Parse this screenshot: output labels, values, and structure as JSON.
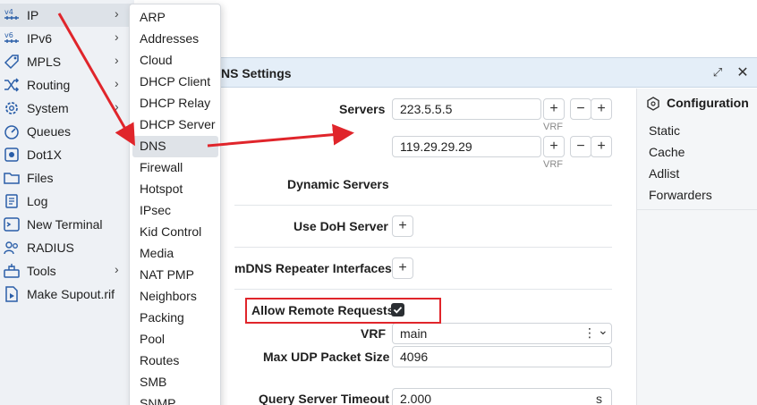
{
  "sidebar": {
    "items": [
      {
        "label": "IP",
        "icon": "ipv4-icon",
        "chevron": "›"
      },
      {
        "label": "IPv6",
        "icon": "ipv6-icon",
        "chevron": "›"
      },
      {
        "label": "MPLS",
        "icon": "tag-icon",
        "chevron": "›"
      },
      {
        "label": "Routing",
        "icon": "shuffle-icon",
        "chevron": "›"
      },
      {
        "label": "System",
        "icon": "gear-icon",
        "chevron": "›"
      },
      {
        "label": "Queues",
        "icon": "gauge-icon",
        "chevron": ""
      },
      {
        "label": "Dot1X",
        "icon": "dot1x-icon",
        "chevron": ""
      },
      {
        "label": "Files",
        "icon": "folder-icon",
        "chevron": ""
      },
      {
        "label": "Log",
        "icon": "log-icon",
        "chevron": ""
      },
      {
        "label": "New Terminal",
        "icon": "terminal-icon",
        "chevron": ""
      },
      {
        "label": "RADIUS",
        "icon": "users-icon",
        "chevron": ""
      },
      {
        "label": "Tools",
        "icon": "toolbox-icon",
        "chevron": "›"
      },
      {
        "label": "Make Supout.rif",
        "icon": "document-play-icon",
        "chevron": ""
      }
    ]
  },
  "submenu": {
    "items": [
      "ARP",
      "Addresses",
      "Cloud",
      "DHCP Client",
      "DHCP Relay",
      "DHCP Server",
      "DNS",
      "Firewall",
      "Hotspot",
      "IPsec",
      "Kid Control",
      "Media",
      "NAT PMP",
      "Neighbors",
      "Packing",
      "Pool",
      "Routes",
      "SMB",
      "SNMP"
    ],
    "active": "DNS"
  },
  "window": {
    "title": "NS Settings",
    "restore_icon": "⤢",
    "close_icon": "✕",
    "servers_label": "Servers",
    "servers": [
      "223.5.5.5",
      "119.29.29.29"
    ],
    "vrf_note": "VRF",
    "plus": "+",
    "minus": "−",
    "dynamic_servers_label": "Dynamic Servers",
    "use_doh_label": "Use DoH Server",
    "mdns_label": "mDNS Repeater Interfaces",
    "allow_remote_label": "Allow Remote Requests",
    "allow_remote_checked": true,
    "vrf_label": "VRF",
    "vrf_value": "main",
    "vrf_menu_icon": "⋮",
    "vrf_chevron": "⌄",
    "max_udp_label": "Max UDP Packet Size",
    "max_udp_value": "4096",
    "query_timeout_label": "Query Server Timeout",
    "query_timeout_value": "2.000",
    "query_timeout_unit": "s"
  },
  "config_panel": {
    "title": "Configuration",
    "items": [
      "Static",
      "Cache",
      "Adlist",
      "Forwarders"
    ]
  },
  "colors": {
    "annotation_red": "#e0252b",
    "titlebar": "#e4eef8",
    "sidebar_bg": "#eef1f5"
  }
}
